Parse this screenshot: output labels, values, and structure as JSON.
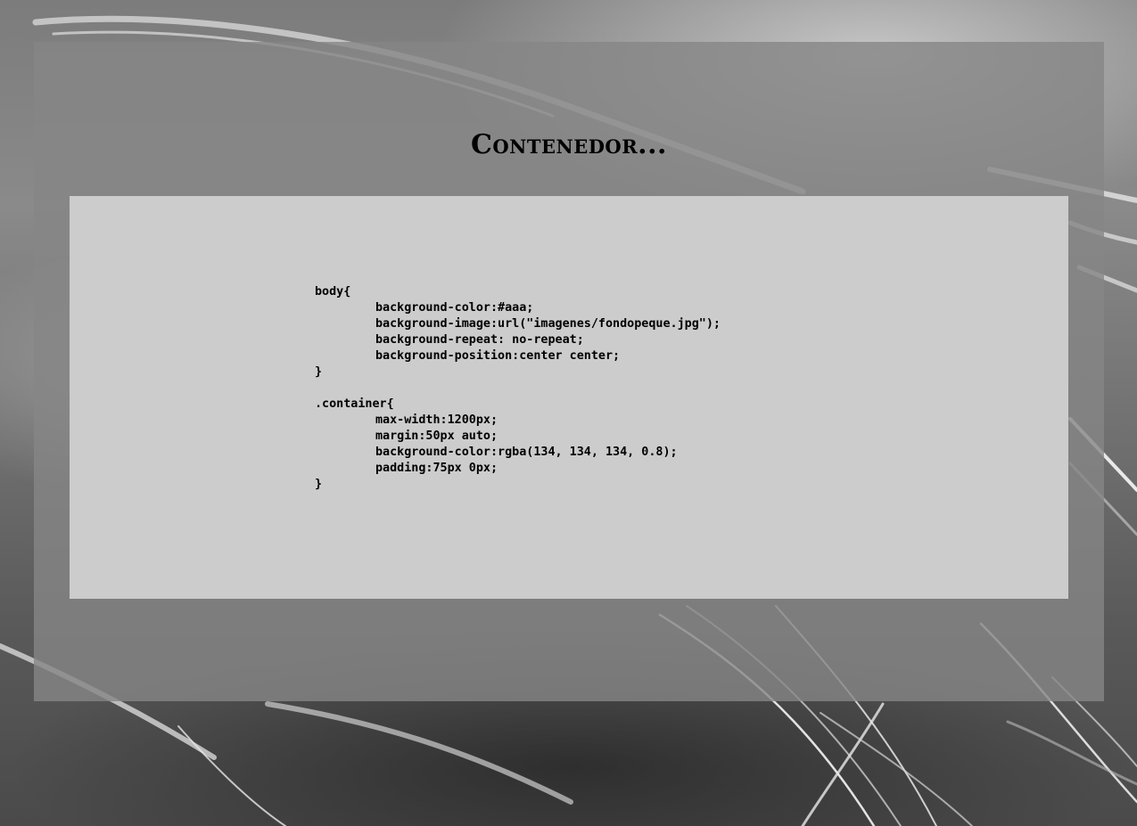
{
  "page": {
    "title": "Contenedor..."
  },
  "code_sample": {
    "lines": [
      {
        "indent": false,
        "text": "body{"
      },
      {
        "indent": true,
        "text": "background-color:#aaa;"
      },
      {
        "indent": true,
        "text": "background-image:url(\"imagenes/fondopeque.jpg\");"
      },
      {
        "indent": true,
        "text": "background-repeat: no-repeat;"
      },
      {
        "indent": true,
        "text": "background-position:center center;"
      },
      {
        "indent": false,
        "text": "}"
      },
      {
        "indent": false,
        "text": ""
      },
      {
        "indent": false,
        "text": ".container{"
      },
      {
        "indent": true,
        "text": "max-width:1200px;"
      },
      {
        "indent": true,
        "text": "margin:50px auto;"
      },
      {
        "indent": true,
        "text": "background-color:rgba(134, 134, 134, 0.8);"
      },
      {
        "indent": true,
        "text": "padding:75px 0px;"
      },
      {
        "indent": false,
        "text": "}"
      }
    ]
  },
  "colors": {
    "container_bg": "rgba(134, 134, 134, 0.8)",
    "code_box_bg": "#cccccc",
    "text": "#000000"
  },
  "background": {
    "description_icon": "grass-photo-background"
  }
}
